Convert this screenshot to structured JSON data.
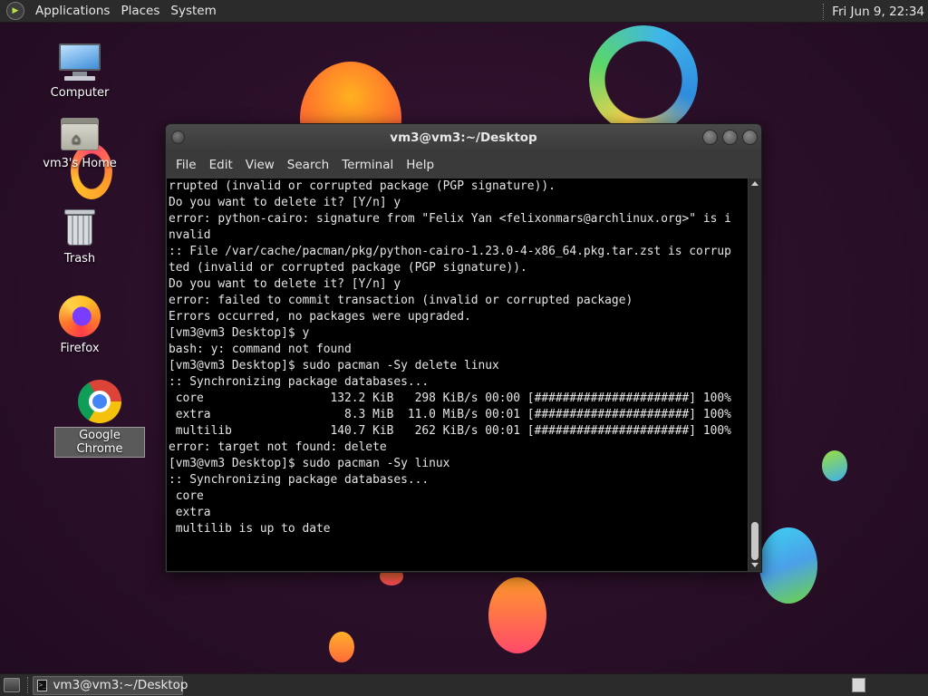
{
  "top_panel": {
    "menus": [
      "Applications",
      "Places",
      "System"
    ],
    "clock": "Fri Jun  9, 22:34"
  },
  "desktop_icons": [
    {
      "label": "Computer",
      "icon": "computer-icon"
    },
    {
      "label": "vm3's Home",
      "icon": "home-folder-icon"
    },
    {
      "label": "Trash",
      "icon": "trash-icon"
    },
    {
      "label": "Firefox",
      "icon": "firefox-icon"
    },
    {
      "label": "Google Chrome",
      "icon": "chrome-icon",
      "selected": true
    }
  ],
  "terminal": {
    "title": "vm3@vm3:~/Desktop",
    "menus": [
      "File",
      "Edit",
      "View",
      "Search",
      "Terminal",
      "Help"
    ],
    "lines": [
      "rrupted (invalid or corrupted package (PGP signature)).",
      "Do you want to delete it? [Y/n] y",
      "error: python-cairo: signature from \"Felix Yan <felixonmars@archlinux.org>\" is i",
      "nvalid",
      ":: File /var/cache/pacman/pkg/python-cairo-1.23.0-4-x86_64.pkg.tar.zst is corrup",
      "ted (invalid or corrupted package (PGP signature)).",
      "Do you want to delete it? [Y/n] y",
      "error: failed to commit transaction (invalid or corrupted package)",
      "Errors occurred, no packages were upgraded.",
      "[vm3@vm3 Desktop]$ y",
      "bash: y: command not found",
      "[vm3@vm3 Desktop]$ sudo pacman -Sy delete linux",
      ":: Synchronizing package databases...",
      " core                  132.2 KiB   298 KiB/s 00:00 [######################] 100%",
      " extra                   8.3 MiB  11.0 MiB/s 00:01 [######################] 100%",
      " multilib              140.7 KiB   262 KiB/s 00:01 [######################] 100%",
      "error: target not found: delete",
      "[vm3@vm3 Desktop]$ sudo pacman -Sy linux",
      ":: Synchronizing package databases...",
      " core",
      " extra",
      " multilib is up to date"
    ]
  },
  "bottom_panel": {
    "task_label": "vm3@vm3:~/Desktop",
    "task_icon": "terminal-icon"
  },
  "colors": {
    "panel": "#2b2b2b",
    "terminal_bg": "#000000",
    "terminal_fg": "#e6e6e6",
    "desktop_bg": "#2a0f28"
  }
}
